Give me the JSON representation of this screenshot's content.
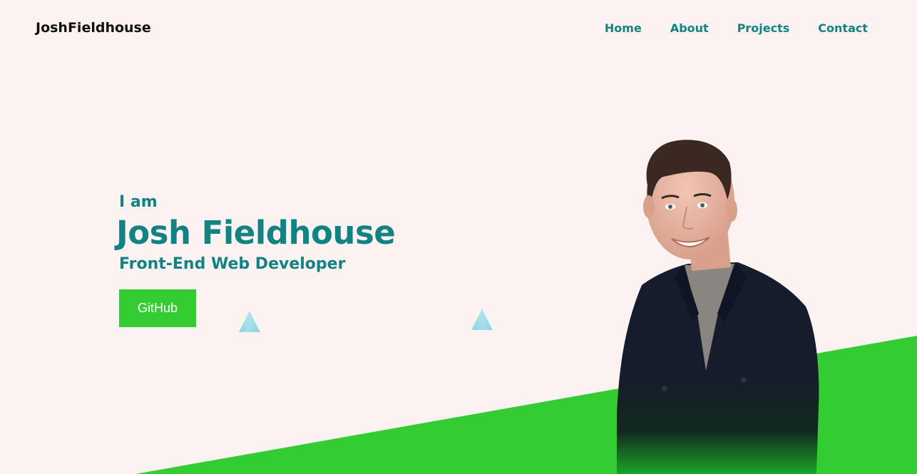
{
  "header": {
    "logo": "JoshFieldhouse",
    "nav": [
      "Home",
      "About",
      "Projects",
      "Contact"
    ]
  },
  "hero": {
    "intro": "I am",
    "name": "Josh Fieldhouse",
    "role": "Front-End Web Developer",
    "cta_label": "GitHub"
  },
  "decor": {
    "shapes": [
      "triangle-icon",
      "triangle-icon"
    ]
  },
  "colors": {
    "background": "#fcf2f1",
    "accent_teal": "#128282",
    "accent_green": "#33cc33"
  }
}
